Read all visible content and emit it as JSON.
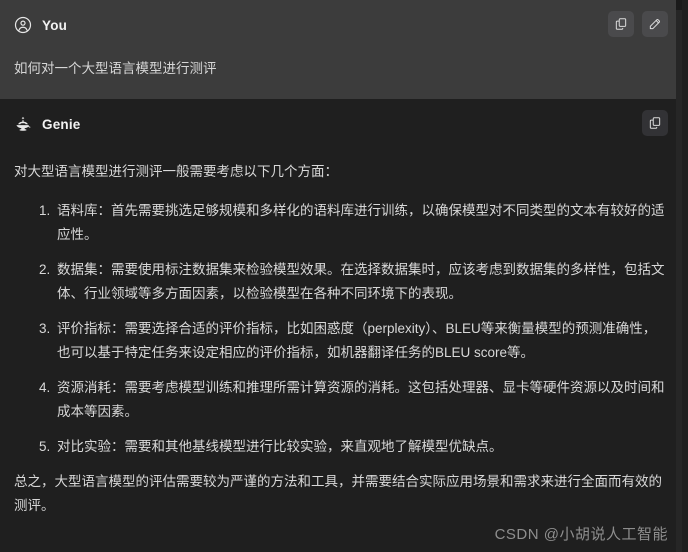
{
  "conversation": {
    "user_turn": {
      "role_label": "You",
      "avatar_icon": "user-circle-icon",
      "actions": [
        {
          "name": "copy-button",
          "icon": "copy-icon"
        },
        {
          "name": "edit-button",
          "icon": "pencil-edit-icon"
        }
      ],
      "message": "如何对一个大型语言模型进行测评"
    },
    "assistant_turn": {
      "role_label": "Genie",
      "avatar_icon": "genie-lamp-icon",
      "actions": [
        {
          "name": "copy-button",
          "icon": "copy-icon"
        }
      ],
      "intro": "对大型语言模型进行测评一般需要考虑以下几个方面：",
      "points": [
        "语料库：首先需要挑选足够规模和多样化的语料库进行训练，以确保模型对不同类型的文本有较好的适应性。",
        "数据集：需要使用标注数据集来检验模型效果。在选择数据集时，应该考虑到数据集的多样性，包括文体、行业领域等多方面因素，以检验模型在各种不同环境下的表现。",
        "评价指标：需要选择合适的评价指标，比如困惑度（perplexity）、BLEU等来衡量模型的预测准确性，也可以基于特定任务来设定相应的评价指标，如机器翻译任务的BLEU score等。",
        "资源消耗：需要考虑模型训练和推理所需计算资源的消耗。这包括处理器、显卡等硬件资源以及时间和成本等因素。",
        "对比实验：需要和其他基线模型进行比较实验，来直观地了解模型优缺点。"
      ],
      "conclusion": "总之，大型语言模型的评估需要较为严谨的方法和工具，并需要结合实际应用场景和需求来进行全面而有效的测评。"
    }
  },
  "watermark": "CSDN @小胡说人工智能",
  "colors": {
    "user_turn_bg": "#3c3c3c",
    "assistant_turn_bg": "#1f1f1f",
    "text_primary": "#d8d8d8",
    "role_label": "#f2f2f2",
    "watermark": "#8e8e8e"
  }
}
